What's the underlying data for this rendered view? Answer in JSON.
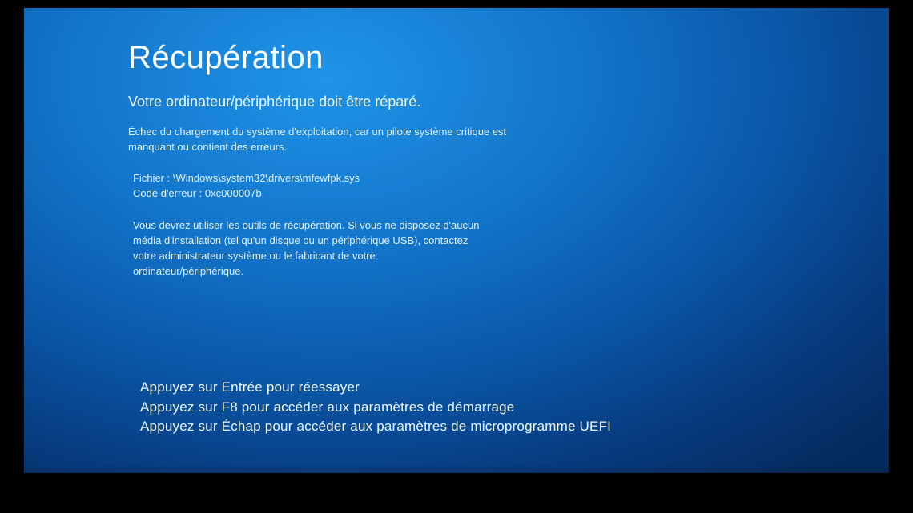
{
  "title": "Récupération",
  "subtitle": "Votre ordinateur/périphérique doit être réparé.",
  "error_description": "Échec du chargement du système d'exploitation, car un pilote système critique est manquant ou contient des erreurs.",
  "file_label": "Fichier : ",
  "file_path": "\\Windows\\system32\\drivers\\mfewfpk.sys",
  "error_code_label": "Code d'erreur : ",
  "error_code": "0xc000007b",
  "instructions": "Vous devrez utiliser les outils de récupération. Si vous ne disposez d'aucun média d'installation (tel qu'un disque ou un périphérique USB), contactez votre administrateur système ou le fabricant de votre ordinateur/périphérique.",
  "key_prompts": {
    "enter": "Appuyez sur Entrée pour réessayer",
    "f8": "Appuyez sur F8 pour accéder aux paramètres de démarrage",
    "esc": "Appuyez sur Échap pour accéder aux paramètres de microprogramme UEFI"
  }
}
